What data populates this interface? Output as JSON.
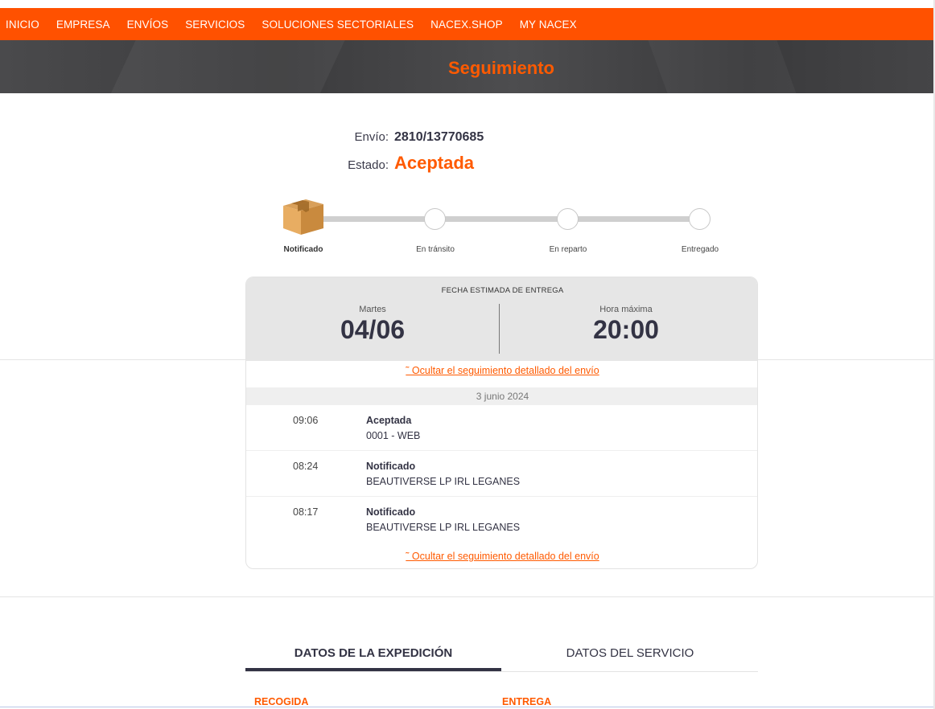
{
  "nav": {
    "items": [
      "INICIO",
      "EMPRESA",
      "ENVÍOS",
      "SERVICIOS",
      "SOLUCIONES SECTORIALES",
      "NACEX.SHOP",
      "MY NACEX"
    ]
  },
  "hero": {
    "title": "Seguimiento"
  },
  "shipment": {
    "envio_label": "Envío:",
    "envio_value": "2810/13770685",
    "estado_label": "Estado:",
    "estado_value": "Aceptada"
  },
  "tracker": {
    "icon": "package-box-icon",
    "steps": [
      "Notificado",
      "En tránsito",
      "En reparto",
      "Entregado"
    ],
    "current_step": 1
  },
  "delivery": {
    "title": "FECHA ESTIMADA DE ENTREGA",
    "day_label": "Martes",
    "date": "04/06",
    "time_label": "Hora máxima",
    "time": "20:00"
  },
  "history": {
    "toggle_label": "˜ Ocultar el seguimiento detallado del envío",
    "date": "3 junio 2024",
    "events": [
      {
        "time": "09:06",
        "status": "Aceptada",
        "location": "0001 - WEB"
      },
      {
        "time": "08:24",
        "status": "Notificado",
        "location": "BEAUTIVERSE LP IRL LEGANES"
      },
      {
        "time": "08:17",
        "status": "Notificado",
        "location": "BEAUTIVERSE LP IRL LEGANES"
      }
    ]
  },
  "tabs": {
    "items": [
      "DATOS DE LA EXPEDICIÓN",
      "DATOS DEL SERVICIO"
    ],
    "active": 0
  },
  "sections": {
    "recogida": "RECOGIDA",
    "entrega": "ENTREGA"
  },
  "colors": {
    "brand": "#ff5100",
    "accent_text": "#ff5a00",
    "dark_text": "#333344"
  }
}
